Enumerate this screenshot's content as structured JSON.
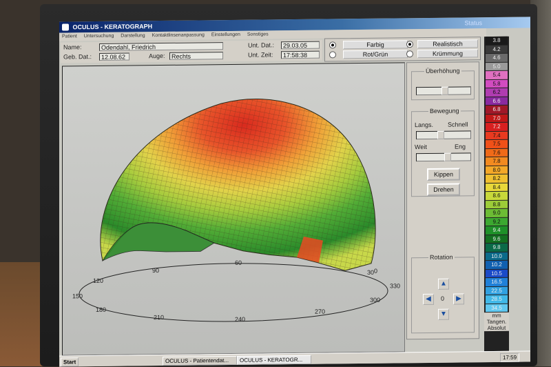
{
  "window": {
    "title": "OCULUS - KERATOGRAPH",
    "subtitle": "Status"
  },
  "menu": [
    "Patient",
    "Untersuchung",
    "Darstellung",
    "Kontaktlinsenanpassung",
    "Einstellungen",
    "Sonstiges"
  ],
  "patient": {
    "name_label": "Name:",
    "name_value": "Odendahl, Friedrich",
    "dob_label": "Geb. Dat.:",
    "dob_value": "12.08.62",
    "eye_label": "Auge:",
    "eye_value": "Rechts",
    "date_label": "Unt. Dat.:",
    "date_value": "29.03.05",
    "time_label": "Unt. Zeit:",
    "time_value": "17:58:38"
  },
  "display_options": {
    "color_mode": [
      {
        "label": "Farbig",
        "selected": true
      },
      {
        "label": "Rot/Grün",
        "selected": false
      }
    ],
    "render_mode": [
      {
        "label": "Realistisch",
        "selected": true
      },
      {
        "label": "Krümmung",
        "selected": false
      }
    ]
  },
  "axis_labels": [
    "90",
    "60",
    "30",
    "0",
    "330",
    "300",
    "270",
    "240",
    "210",
    "180",
    "150",
    "120"
  ],
  "controls": {
    "exaggeration_title": "Überhöhung",
    "movement_title": "Bewegung",
    "slow_label": "Langs.",
    "fast_label": "Schnell",
    "wide_label": "Weit",
    "narrow_label": "Eng",
    "tilt_button": "Kippen",
    "rotate_button": "Drehen",
    "rotation_title": "Rotation",
    "rotation_value": "0"
  },
  "scale": {
    "values": [
      "3.8",
      "4.2",
      "4.6",
      "5.0",
      "5.4",
      "5.8",
      "6.2",
      "6.6",
      "6.8",
      "7.0",
      "7.2",
      "7.4",
      "7.5",
      "7.6",
      "7.8",
      "8.0",
      "8.2",
      "8.4",
      "8.6",
      "8.8",
      "9.0",
      "9.2",
      "9.4",
      "9.6",
      "9.8",
      "10.0",
      "10.2",
      "10.5",
      "16.5",
      "22.5",
      "28.5",
      "34.5"
    ],
    "colors": [
      "#1a1a1a",
      "#3a3a3a",
      "#6a6a6a",
      "#9a9a9a",
      "#e070c0",
      "#d24cc0",
      "#b03cb0",
      "#8a2aa0",
      "#a01828",
      "#c01818",
      "#d82020",
      "#e83a20",
      "#f05018",
      "#f06a18",
      "#f28a20",
      "#f4a828",
      "#f0c030",
      "#e8d83a",
      "#c8d83a",
      "#9ccc38",
      "#6cbc34",
      "#3ca830",
      "#1e9028",
      "#137020",
      "#0a6a48",
      "#0b6a8a",
      "#1060b0",
      "#1a4ac8",
      "#2080d8",
      "#30a0e0",
      "#40b8e8",
      "#60c8f0"
    ],
    "unit": "mm",
    "mode1": "Tangen.",
    "mode2": "Absolut"
  },
  "taskbar": {
    "start": "Start",
    "task1": "OCULUS - Patientendat...",
    "task2": "OCULUS - KERATOGR...",
    "clock": "17:59"
  }
}
